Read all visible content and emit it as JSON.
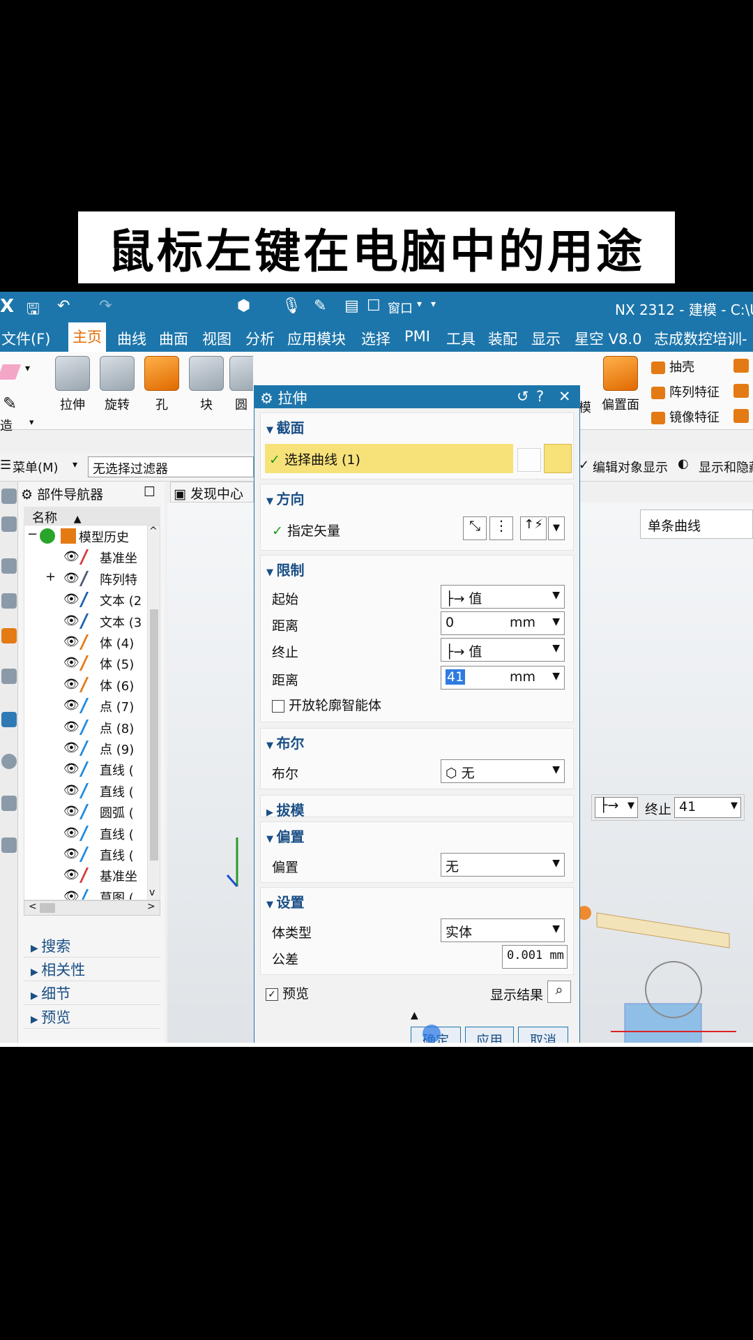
{
  "banner": {
    "title": "鼠标左键在电脑中的用途"
  },
  "titlebar": {
    "logo": "X",
    "window_menu": "窗口",
    "app_title": "NX 2312 - 建模 - C:\\U"
  },
  "menubar": {
    "items": [
      "文件(F)",
      "主页",
      "曲线",
      "曲面",
      "视图",
      "分析",
      "应用模块",
      "选择",
      "PMI",
      "工具",
      "装配",
      "显示",
      "星空 V8.0",
      "志成数控培训-"
    ]
  },
  "ribbon": {
    "buttons": [
      "拉伸",
      "旋转",
      "孔",
      "块",
      "圆"
    ],
    "partial_label": "模",
    "offset_face": "偏置面",
    "right_items": [
      "抽壳",
      "阵列特征",
      "镜像特征"
    ],
    "left_label": "造"
  },
  "toolbar2": {
    "menu": "菜单(M)",
    "filter": "无选择过滤器",
    "edit_display": "编辑对象显示",
    "show_hide": "显示和隐藏"
  },
  "nav": {
    "title": "部件导航器",
    "column": "名称",
    "discover": "发现中心",
    "tree": [
      "模型历史",
      "基准坐",
      "阵列特",
      "文本 (2",
      "文本 (3",
      "体 (4)",
      "体 (5)",
      "体 (6)",
      "点 (7)",
      "点 (8)",
      "点 (9)",
      "直线 (",
      "直线 (",
      "圆弧 (",
      "直线 (",
      "直线 (",
      "基准坐",
      "草图 ("
    ],
    "sections": [
      "搜索",
      "相关性",
      "细节",
      "预览"
    ]
  },
  "viewport": {
    "single_curve": "单条曲线",
    "end_label": "终止",
    "end_value": "41"
  },
  "dialog": {
    "title": "拉伸",
    "sections": {
      "section": "截面",
      "direction": "方向",
      "limits": "限制",
      "boolean": "布尔",
      "draft": "拔模",
      "offset": "偏置",
      "settings": "设置"
    },
    "select_curve": "选择曲线 (1)",
    "specify_vector": "指定矢量",
    "start_label": "起始",
    "start_value": "值",
    "distance_label": "距离",
    "start_distance": "0",
    "unit": "mm",
    "end_label": "终止",
    "end_value": "值",
    "end_distance": "41",
    "open_profile": "开放轮廓智能体",
    "boolean_label": "布尔",
    "boolean_value": "无",
    "offset_label": "偏置",
    "offset_value": "无",
    "body_type_label": "体类型",
    "body_type_value": "实体",
    "tolerance_label": "公差",
    "tolerance_value": "0.001",
    "tolerance_unit": "mm",
    "preview_label": "预览",
    "show_result": "显示结果",
    "ok": "确定",
    "apply": "应用",
    "cancel": "取消"
  },
  "colors": {
    "accent": "#1d76ab",
    "selection": "#f7e27a",
    "ribbon_orange": "#e46a00"
  }
}
